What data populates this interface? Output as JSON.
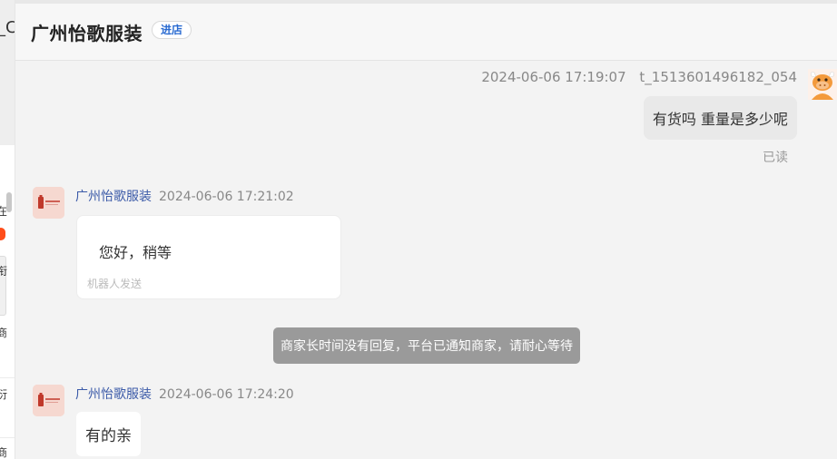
{
  "header": {
    "store_name": "广州怡歌服装",
    "enter_store_label": "进店"
  },
  "left_panel": {
    "fragments": [
      "_C",
      "在",
      "衔",
      "商",
      "衍",
      "商"
    ]
  },
  "messages": {
    "user_message": {
      "timestamp": "2024-06-06 17:19:07",
      "user_id": "t_1513601496182_054",
      "text": "有货吗 重量是多少呢",
      "status": "已读"
    },
    "shop_message_1": {
      "sender": "广州怡歌服装",
      "timestamp": "2024-06-06 17:21:02",
      "text": "您好，稍等",
      "footnote": "机器人发送"
    },
    "system_notice": "商家长时间没有回复，平台已通知商家，请耐心等待",
    "shop_message_2": {
      "sender": "广州怡歌服装",
      "timestamp": "2024-06-06 17:24:20",
      "text": "有的亲"
    }
  },
  "colors": {
    "accent_blue": "#2a6bd1",
    "sender_blue": "#3b5aa8",
    "notice_bg": "#9a9a9a",
    "shop_avatar_bg": "#f6d8d0",
    "user_avatar_orange": "#f39a3c"
  },
  "icons": {
    "user_avatar": "cartoon-bull-avatar-icon",
    "shop_avatar": "shop-logo-avatar-icon"
  }
}
